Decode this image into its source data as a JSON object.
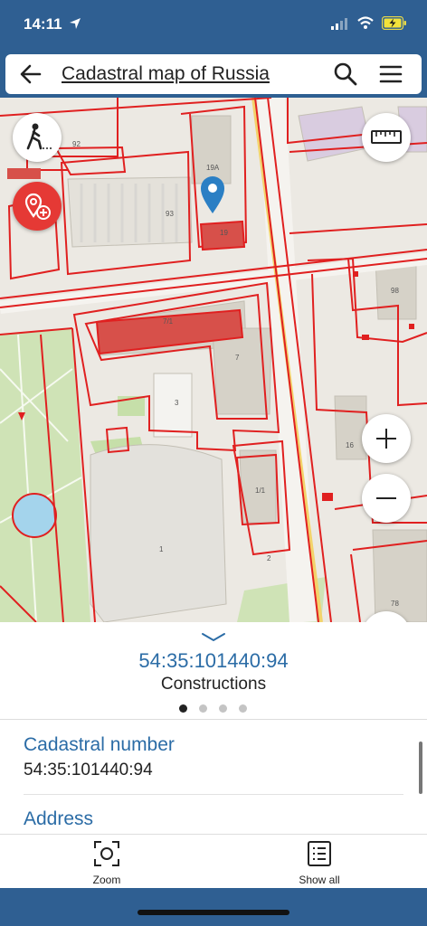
{
  "status": {
    "time": "14:11"
  },
  "header": {
    "title": "Cadastral map of Russia"
  },
  "map": {
    "labels": [
      "92",
      "93",
      "19A",
      "19",
      "7/1",
      "7",
      "3",
      "1",
      "1/1",
      "16",
      "98",
      "78",
      "2"
    ]
  },
  "panel": {
    "cadastral_number_heading": "54:35:101440:94",
    "object_type": "Constructions",
    "fields": [
      {
        "label": "Cadastral number",
        "value": "54:35:101440:94"
      },
      {
        "label": "Address",
        "value": ""
      }
    ]
  },
  "bottom_bar": {
    "zoom_label": "Zoom",
    "show_all_label": "Show all"
  },
  "colors": {
    "accent": "#2b6ca6",
    "status_bar": "#2f5f92",
    "parcel_red": "#e02020",
    "fab_red": "#e53935"
  }
}
